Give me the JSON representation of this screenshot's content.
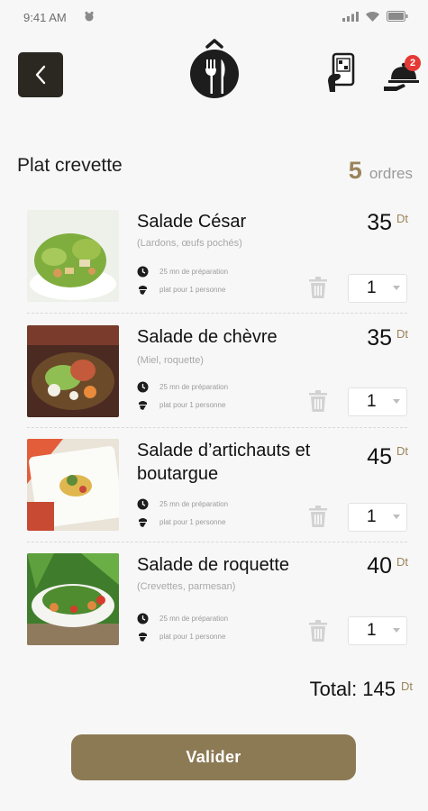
{
  "status_bar": {
    "time": "9:41 AM"
  },
  "header": {
    "notification_count": "2"
  },
  "section": {
    "title": "Plat crevette",
    "order_count": "5",
    "order_label": "ordres"
  },
  "items": [
    {
      "name": "Salade César",
      "description": "(Lardons, œufs pochés)",
      "prep": "25 mn de préparation",
      "serving": "plat pour  1 personne",
      "price": "35",
      "currency": "Dt",
      "quantity": "1"
    },
    {
      "name": "Salade de chèvre",
      "description": "(Miel, roquette)",
      "prep": "25 mn de préparation",
      "serving": "plat pour  1 personne",
      "price": "35",
      "currency": "Dt",
      "quantity": "1"
    },
    {
      "name": "Salade d’artichauts et boutargue",
      "description": "",
      "prep": "25 mn de préparation",
      "serving": "plat pour  1 personne",
      "price": "45",
      "currency": "Dt",
      "quantity": "1"
    },
    {
      "name": "Salade de roquette",
      "description": "(Crevettes, parmesan)",
      "prep": "25 mn de préparation",
      "serving": "plat pour  1 personne",
      "price": "40",
      "currency": "Dt",
      "quantity": "1"
    }
  ],
  "total": {
    "label": "Total: 145",
    "currency": "Dt"
  },
  "submit_label": "Valider",
  "colors": {
    "accent": "#9a845a",
    "button": "#8c7a55",
    "dark": "#2b2822"
  }
}
